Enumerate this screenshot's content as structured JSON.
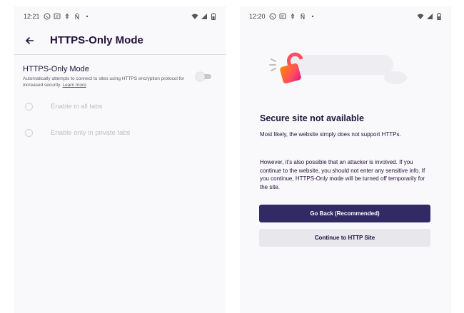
{
  "left": {
    "status": {
      "time": "12:21"
    },
    "toolbar": {
      "title": "HTTPS-Only Mode"
    },
    "setting": {
      "title": "HTTPS-Only Mode",
      "description": "Automatically attempts to connect to sites using HTTPS encryption protocol for increased security.",
      "learn_more": "Learn more",
      "toggle_on": false
    },
    "options": [
      {
        "label": "Enable in all tabs",
        "selected": false
      },
      {
        "label": "Enable only in private tabs",
        "selected": false
      }
    ]
  },
  "right": {
    "status": {
      "time": "12:20"
    },
    "error": {
      "title": "Secure site not available",
      "paragraph1": "Most likely, the website simply does not support HTTPs.",
      "paragraph2": "However, it’s also possible that an attacker is involved. If you continue to the website, you should not enter any sensitive info. If you continue, HTTPS-Only mode will be turned off temporarily for the site."
    },
    "buttons": {
      "go_back": "Go Back (Recommended)",
      "continue": "Continue to HTTP Site"
    }
  },
  "colors": {
    "primary_button": "#312a65",
    "secondary_button": "#e8e7ec",
    "text": "#20123a",
    "lock_gradient_start": "#ff4f5e",
    "lock_gradient_end": "#ff8a00"
  }
}
